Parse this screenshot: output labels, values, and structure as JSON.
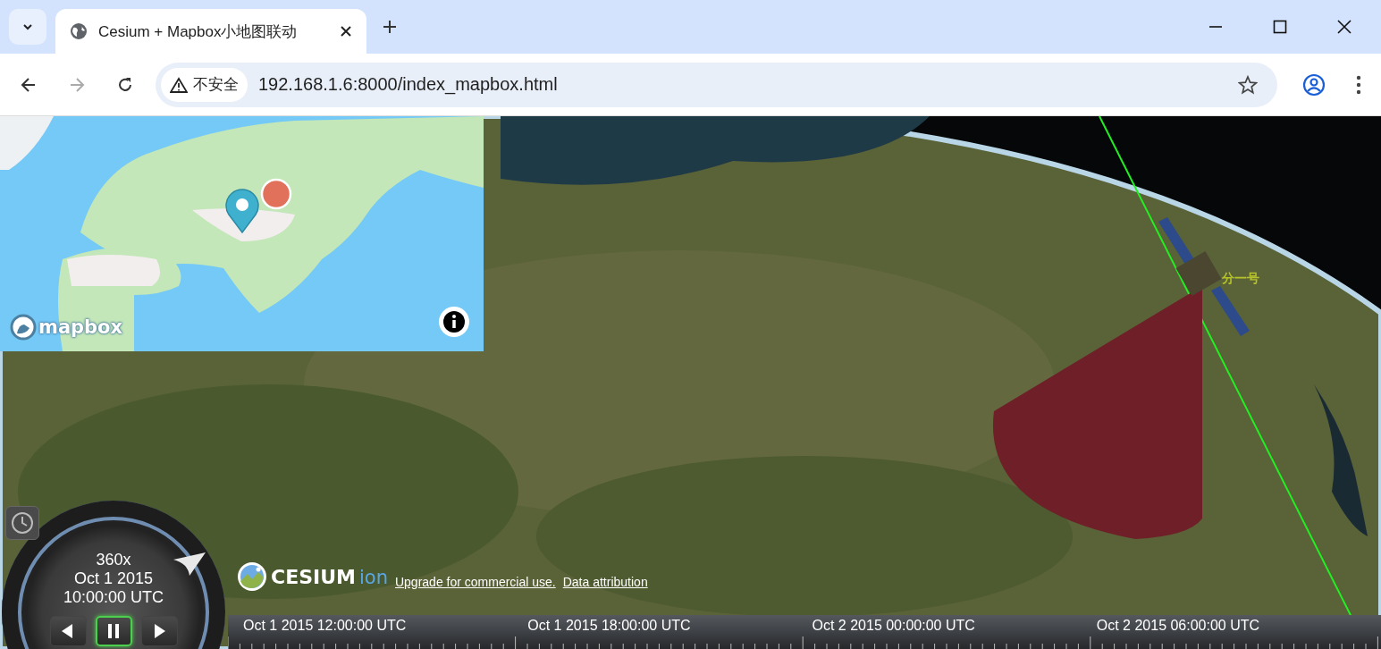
{
  "browser": {
    "tabs": [
      {
        "title": "Cesium + Mapbox小地图联动",
        "selected": true
      }
    ],
    "address": {
      "security_label": "不安全",
      "url": "192.168.1.6:8000/index_mapbox.html"
    }
  },
  "minimap": {
    "logo_text": "mapbox"
  },
  "scene": {
    "satellite_label": "分一号"
  },
  "animation": {
    "speed": "360x",
    "date": "Oct 1 2015",
    "time": "10:00:00 UTC",
    "buttons": [
      {
        "kind": "reverse",
        "selected": false
      },
      {
        "kind": "pause",
        "selected": true
      },
      {
        "kind": "play",
        "selected": false
      }
    ]
  },
  "credits": {
    "logo_text": "CESIUM",
    "logo_suffix": "ion",
    "links": [
      "Upgrade for commercial use.",
      "Data attribution"
    ]
  },
  "timeline": {
    "labels": [
      "Oct 1 2015 12:00:00 UTC",
      "Oct 1 2015 18:00:00 UTC",
      "Oct 2 2015 00:00:00 UTC",
      "Oct 2 2015 06:00:00 UTC"
    ]
  }
}
